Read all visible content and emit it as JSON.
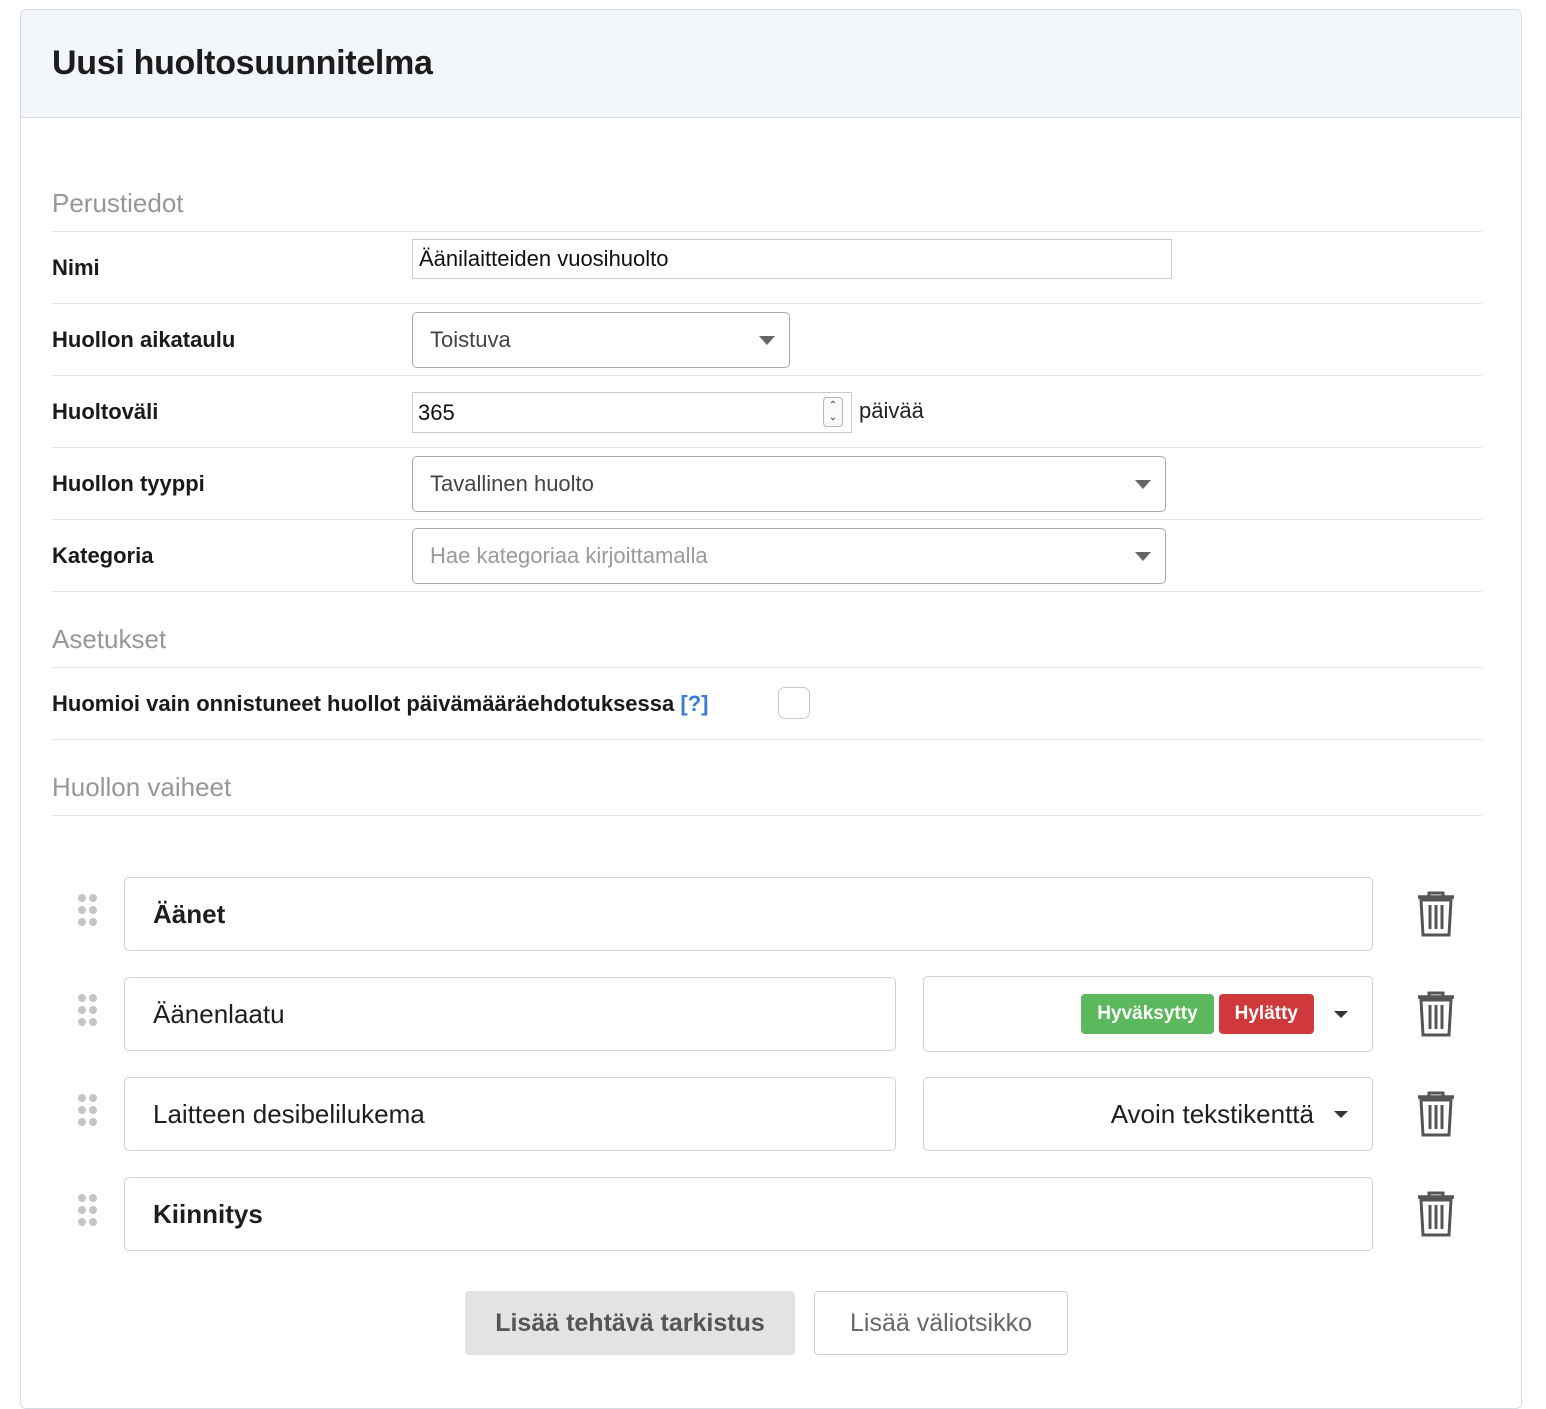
{
  "header": {
    "title": "Uusi huoltosuunnitelma"
  },
  "sections": {
    "basic": "Perustiedot",
    "settings": "Asetukset",
    "steps": "Huollon vaiheet"
  },
  "fields": {
    "name": {
      "label": "Nimi",
      "value": "Äänilaitteiden vuosihuolto"
    },
    "schedule": {
      "label": "Huollon aikataulu",
      "value": "Toistuva"
    },
    "interval": {
      "label": "Huoltoväli",
      "value": "365",
      "unit": "päivää"
    },
    "type": {
      "label": "Huollon tyyppi",
      "value": "Tavallinen huolto"
    },
    "category": {
      "label": "Kategoria",
      "placeholder": "Hae kategoriaa kirjoittamalla"
    }
  },
  "settings": {
    "only_successful": {
      "label": "Huomioi vain onnistuneet huollot päivämääräehdotuksessa",
      "help": "[?]",
      "checked": false
    }
  },
  "steps": [
    {
      "kind": "heading",
      "text": "Äänet"
    },
    {
      "kind": "task",
      "text": "Äänenlaatu",
      "answer_type": "badges",
      "badges": [
        {
          "label": "Hyväksytty",
          "color": "#5cb85c"
        },
        {
          "label": "Hylätty",
          "color": "#d0393b"
        }
      ]
    },
    {
      "kind": "task",
      "text": "Laitteen desibelilukema",
      "answer_type": "Avoin tekstikenttä"
    },
    {
      "kind": "heading",
      "text": "Kiinnitys"
    }
  ],
  "buttons": {
    "add_task": "Lisää tehtävä tarkistus",
    "add_subheading": "Lisää väliotsikko"
  },
  "colors": {
    "accept": "#5cb85c",
    "reject": "#d0393b",
    "help_link": "#3a7bd5"
  }
}
